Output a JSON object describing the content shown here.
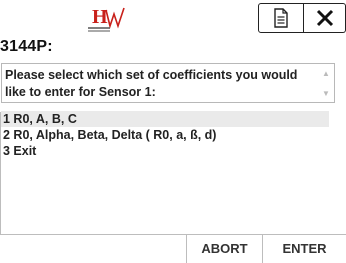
{
  "header": {
    "logo_icon": "hw-logo-icon",
    "logo_text": "H",
    "document_button_icon": "document-icon",
    "close_button_icon": "close-icon",
    "title": "3144P:"
  },
  "prompt": {
    "text": "Please select which set of coefficients you would like to enter for Sensor 1:"
  },
  "menu": {
    "items": [
      {
        "label": "1 R0, A, B, C",
        "selected": true
      },
      {
        "label": "2 R0, Alpha, Beta, Delta ( R0, a, ß, d)",
        "selected": false
      },
      {
        "label": "3  Exit",
        "selected": false
      }
    ]
  },
  "footer": {
    "abort_label": "ABORT",
    "enter_label": "ENTER"
  },
  "colors": {
    "logo_red": "#c8201a",
    "text": "#222222",
    "border": "#bdbdbd",
    "selection": "#eaeaea"
  }
}
